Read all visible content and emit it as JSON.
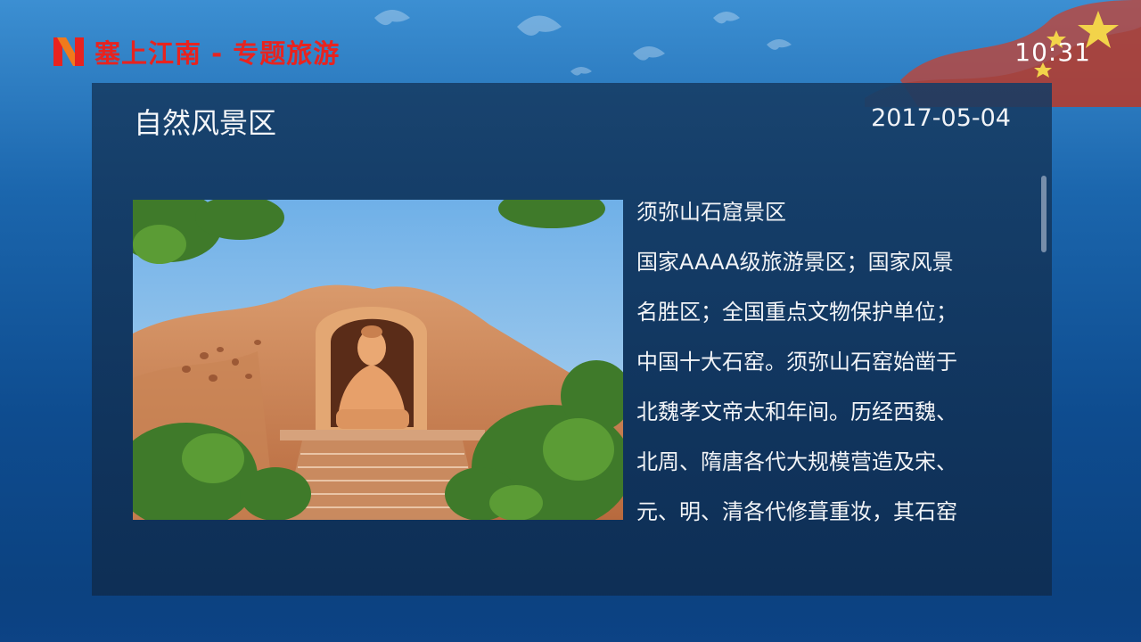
{
  "header": {
    "logo_icon": "n-logo-icon",
    "app_title": "塞上江南 - 专题旅游",
    "clock": "10:31"
  },
  "colors": {
    "brand_red": "#e8231f",
    "panel_bg": "#163c64",
    "text": "#f2f4f7"
  },
  "article": {
    "category": "自然风景区",
    "date": "2017-05-04",
    "lines": [
      "须弥山石窟景区",
      "国家AAAA级旅游景区；国家风景",
      "名胜区；全国重点文物保护单位；",
      "中国十大石窑。须弥山石窑始凿于",
      "北魏孝文帝太和年间。历经西魏、",
      "北周、隋唐各代大规模营造及宋、",
      "元、明、清各代修葺重妆，其石窑"
    ]
  },
  "scroll": {
    "position_fraction": 0.0
  }
}
